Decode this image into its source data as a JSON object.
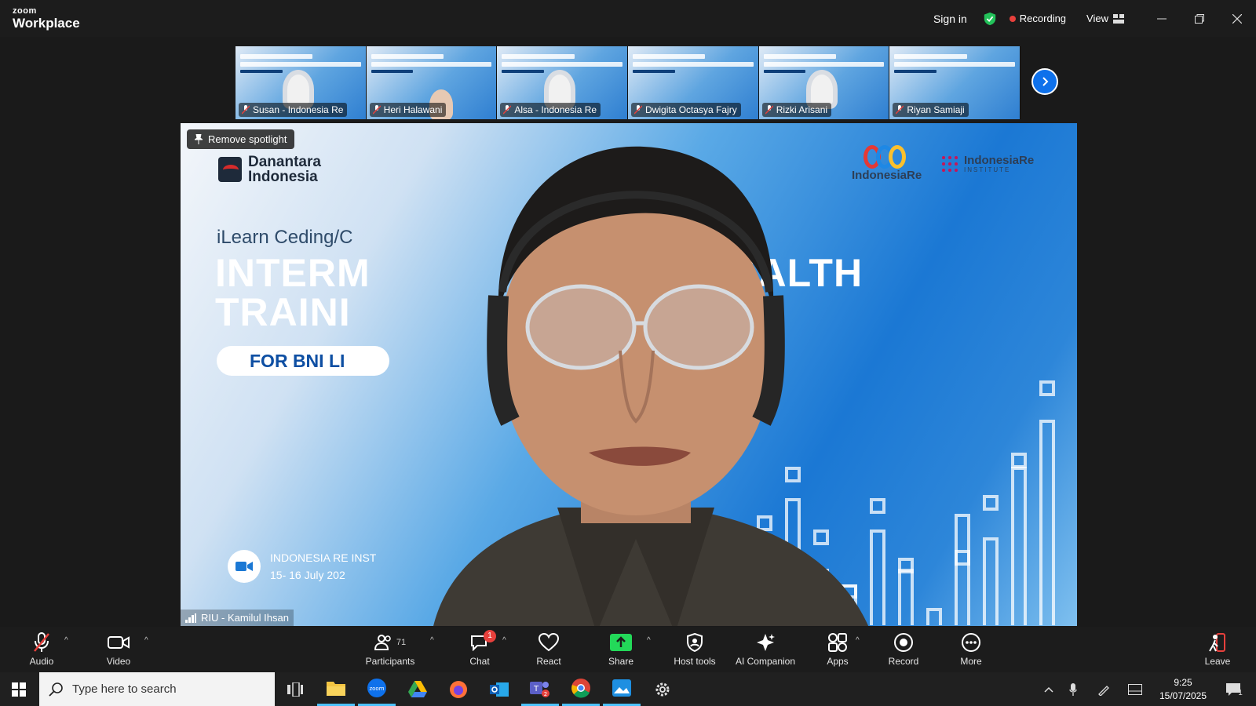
{
  "app": {
    "brand_top": "zoom",
    "brand_bottom": "Workplace",
    "sign_in": "Sign in",
    "recording_label": "Recording",
    "view_label": "View"
  },
  "thumbnails": [
    {
      "name": "Susan - Indonesia Re"
    },
    {
      "name": "Heri Halawani"
    },
    {
      "name": "Alsa - Indonesia Re"
    },
    {
      "name": "Dwigita Octasya Fajry"
    },
    {
      "name": "Rizki Arisani"
    },
    {
      "name": "Riyan Samiaji"
    }
  ],
  "main_video": {
    "spotlight_label": "Remove spotlight",
    "speaker_caption": "RIU - Kamilul Ihsan",
    "slide": {
      "logo_left_line1": "Danantara",
      "logo_left_line2": "Indonesia",
      "logo_right_1": "IndonesiaRe",
      "logo_right_2": "IndonesiaRe",
      "logo_right_2_sub": "INSTITUTE",
      "kicker": "iLearn Ceding/C",
      "headline_1": "INTERM",
      "headline_2": "TRAINI",
      "headline_right": "HEALTH",
      "pill": "FOR BNI LI",
      "venue": "INDONESIA RE INST",
      "dates": "15- 16 July 202"
    }
  },
  "toolbar": {
    "audio": "Audio",
    "video": "Video",
    "participants": "Participants",
    "participants_count": "71",
    "chat": "Chat",
    "chat_badge": "1",
    "react": "React",
    "share": "Share",
    "host_tools": "Host tools",
    "ai_companion": "AI Companion",
    "apps": "Apps",
    "record": "Record",
    "more": "More",
    "leave": "Leave"
  },
  "taskbar": {
    "search_placeholder": "Type here to search",
    "teams_badge": "2",
    "time": "9:25",
    "date": "15/07/2025",
    "notifications": "1"
  },
  "colors": {
    "accent_blue": "#0e71eb",
    "record_red": "#e8403c",
    "share_green": "#23d959"
  }
}
